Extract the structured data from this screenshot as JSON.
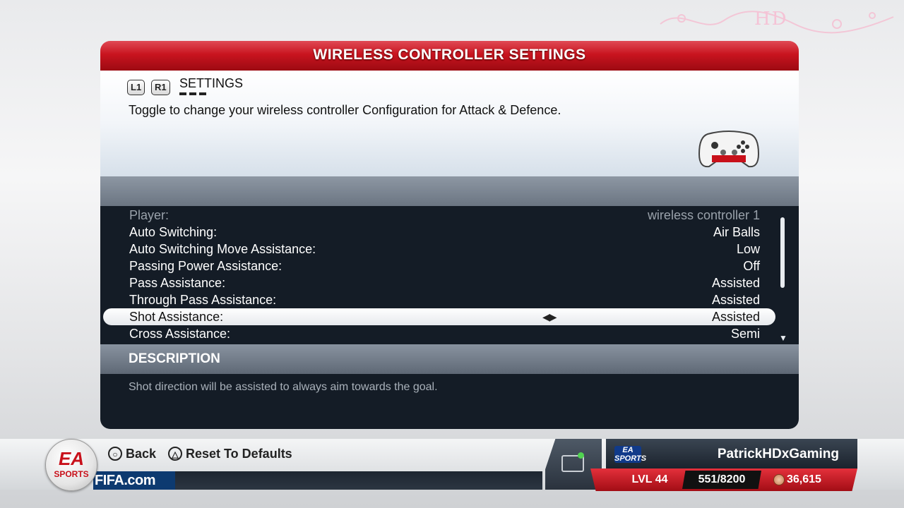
{
  "watermark": {
    "text": "HD"
  },
  "panel": {
    "title": "WIRELESS CONTROLLER SETTINGS",
    "tab_buttons": [
      "L1",
      "R1"
    ],
    "section_label": "SETTINGS",
    "info_text": "Toggle to change your wireless controller Configuration for Attack & Defence."
  },
  "settings": [
    {
      "label": "Player:",
      "value": "wireless controller 1",
      "state": "disabled"
    },
    {
      "label": "Auto Switching:",
      "value": "Air Balls",
      "state": "normal"
    },
    {
      "label": "Auto Switching Move Assistance:",
      "value": "Low",
      "state": "normal"
    },
    {
      "label": "Passing Power Assistance:",
      "value": "Off",
      "state": "normal"
    },
    {
      "label": "Pass Assistance:",
      "value": "Assisted",
      "state": "normal"
    },
    {
      "label": "Through Pass Assistance:",
      "value": "Assisted",
      "state": "normal"
    },
    {
      "label": "Shot Assistance:",
      "value": "Assisted",
      "state": "selected"
    },
    {
      "label": "Cross Assistance:",
      "value": "Semi",
      "state": "normal"
    }
  ],
  "description": {
    "heading": "DESCRIPTION",
    "text": "Shot direction will be assisted to always aim towards the goal."
  },
  "footer": {
    "logo_letters": "EA",
    "logo_sub": "SPORTS",
    "site": "FIFA.com",
    "hints": [
      {
        "glyph": "○",
        "label": "Back"
      },
      {
        "glyph": "△",
        "label": "Reset To Defaults"
      }
    ]
  },
  "profile": {
    "badge": "EA SPORTS",
    "username": "PatrickHDxGaming",
    "level": "LVL 44",
    "xp": "551/8200",
    "coins": "36,615"
  },
  "colors": {
    "header_red": "#c9141f",
    "list_bg": "#141c26",
    "selected_row": "#ffffff",
    "online_dot": "#51d351"
  }
}
